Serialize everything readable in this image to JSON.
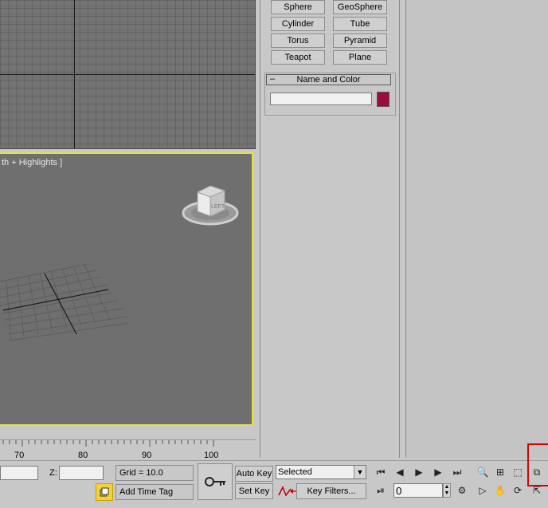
{
  "create_panel": {
    "buttons": [
      {
        "id": "sphere",
        "label": "Sphere"
      },
      {
        "id": "geosphere",
        "label": "GeoSphere"
      },
      {
        "id": "cylinder",
        "label": "Cylinder"
      },
      {
        "id": "tube",
        "label": "Tube"
      },
      {
        "id": "torus",
        "label": "Torus"
      },
      {
        "id": "pyramid",
        "label": "Pyramid"
      },
      {
        "id": "teapot",
        "label": "Teapot"
      },
      {
        "id": "plane",
        "label": "Plane"
      }
    ],
    "name_color_rollout": {
      "collapse_symbol": "–",
      "title": "Name and Color",
      "name_value": "",
      "color": "#9b0e3a"
    }
  },
  "viewport": {
    "perspective_label": "th + Highlights ]",
    "viewcube_label": "LEFT",
    "active_border_color": "#e6e04a"
  },
  "timeline": {
    "ticks": [
      "70",
      "80",
      "90",
      "100"
    ]
  },
  "status": {
    "z_label": "Z:",
    "z_value": "",
    "grid_label": "Grid = 10.0",
    "add_time_tag": "Add Time Tag"
  },
  "animation": {
    "auto_key": "Auto Key",
    "set_key": "Set Key",
    "selected_option": "Selected",
    "key_filters": "Key Filters...",
    "frame_value": "0"
  }
}
